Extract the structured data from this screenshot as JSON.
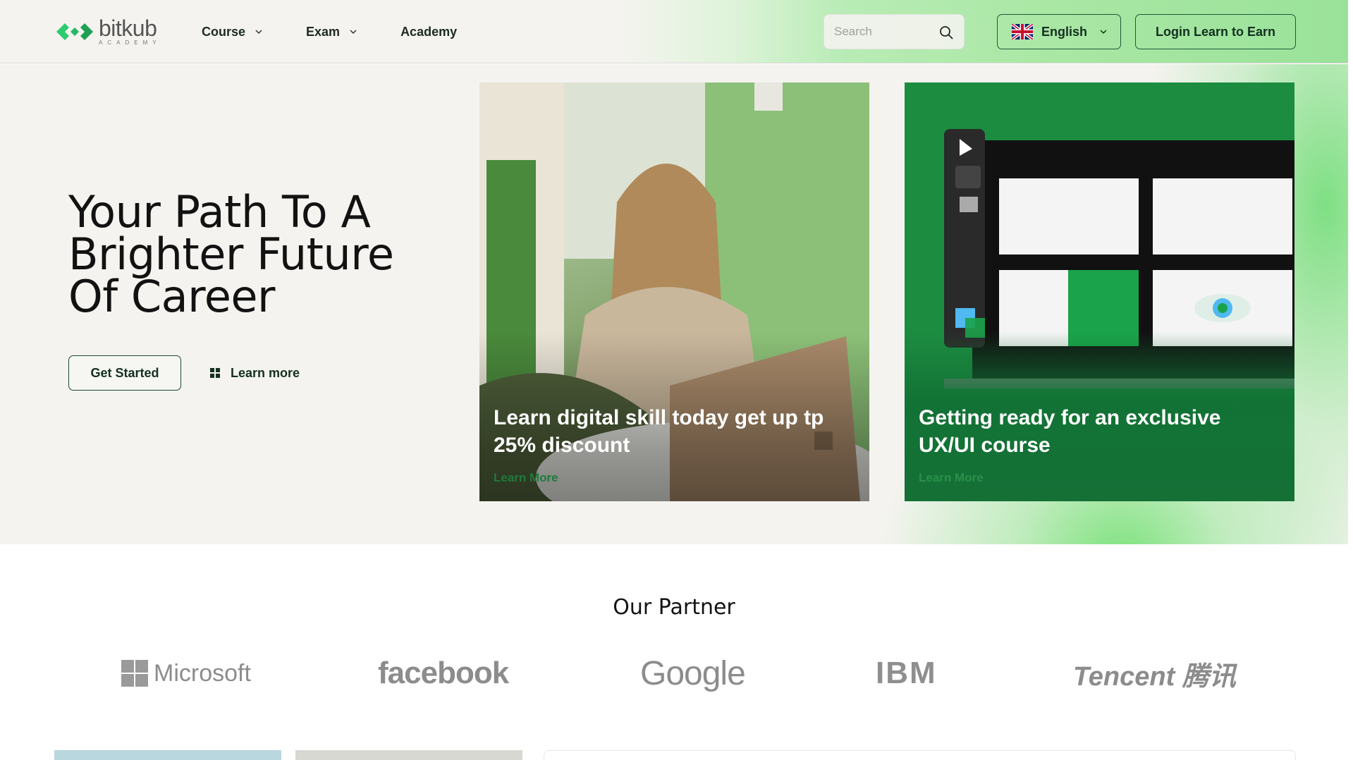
{
  "header": {
    "logo": {
      "word": "bitkub",
      "sub": "ACADEMY",
      "icon": "bitkub-logo-icon"
    },
    "nav": [
      {
        "label": "Course",
        "has_dropdown": true
      },
      {
        "label": "Exam",
        "has_dropdown": true
      },
      {
        "label": "Academy",
        "has_dropdown": false
      }
    ],
    "search": {
      "placeholder": "Search",
      "value": "",
      "icon": "search-icon"
    },
    "language": {
      "label": "English",
      "flag": "uk-flag-icon"
    },
    "login_label": "Login Learn to Earn"
  },
  "hero": {
    "title_lines": [
      "Your Path To A",
      "Brighter Future",
      "Of Career"
    ],
    "get_started": "Get Started",
    "learn_more": "Learn more",
    "cards": [
      {
        "text": "Learn digital skill today get up tp 25% discount",
        "link": "Learn More"
      },
      {
        "text": "Getting ready for an exclusive UX/UI course",
        "link": "Learn More"
      }
    ]
  },
  "partners": {
    "title": "Our Partner",
    "logos": [
      "Microsoft",
      "facebook",
      "Google",
      "IBM",
      "Tencent 腾讯"
    ]
  },
  "colors": {
    "accent_green": "#1b8a3e",
    "dark_text": "#14301f",
    "hero_bg": "#f4f3ef",
    "logo_green": "#2ecc71"
  }
}
